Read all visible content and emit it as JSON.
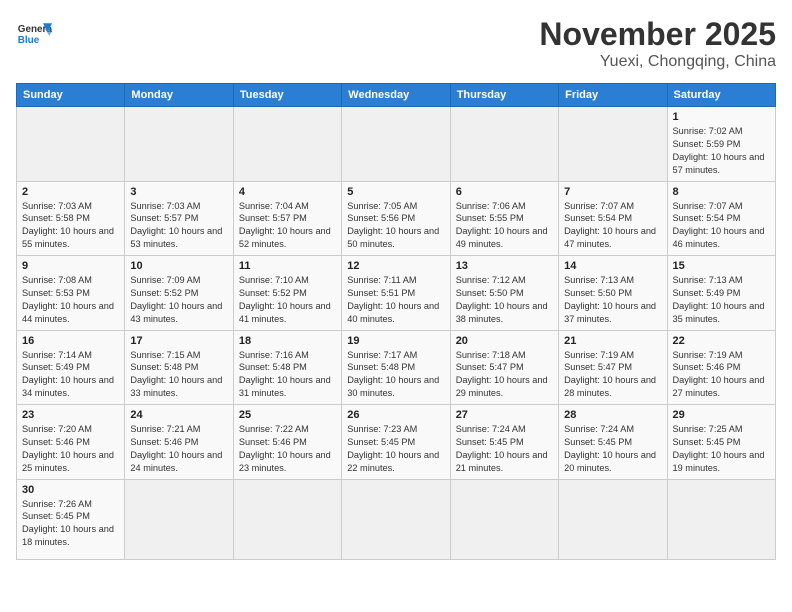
{
  "header": {
    "logo_general": "General",
    "logo_blue": "Blue",
    "title": "November 2025",
    "subtitle": "Yuexi, Chongqing, China"
  },
  "days_of_week": [
    "Sunday",
    "Monday",
    "Tuesday",
    "Wednesday",
    "Thursday",
    "Friday",
    "Saturday"
  ],
  "weeks": [
    [
      {
        "day": "",
        "info": ""
      },
      {
        "day": "",
        "info": ""
      },
      {
        "day": "",
        "info": ""
      },
      {
        "day": "",
        "info": ""
      },
      {
        "day": "",
        "info": ""
      },
      {
        "day": "",
        "info": ""
      },
      {
        "day": "1",
        "info": "Sunrise: 7:02 AM\nSunset: 5:59 PM\nDaylight: 10 hours and 57 minutes."
      }
    ],
    [
      {
        "day": "2",
        "info": "Sunrise: 7:03 AM\nSunset: 5:58 PM\nDaylight: 10 hours and 55 minutes."
      },
      {
        "day": "3",
        "info": "Sunrise: 7:03 AM\nSunset: 5:57 PM\nDaylight: 10 hours and 53 minutes."
      },
      {
        "day": "4",
        "info": "Sunrise: 7:04 AM\nSunset: 5:57 PM\nDaylight: 10 hours and 52 minutes."
      },
      {
        "day": "5",
        "info": "Sunrise: 7:05 AM\nSunset: 5:56 PM\nDaylight: 10 hours and 50 minutes."
      },
      {
        "day": "6",
        "info": "Sunrise: 7:06 AM\nSunset: 5:55 PM\nDaylight: 10 hours and 49 minutes."
      },
      {
        "day": "7",
        "info": "Sunrise: 7:07 AM\nSunset: 5:54 PM\nDaylight: 10 hours and 47 minutes."
      },
      {
        "day": "8",
        "info": "Sunrise: 7:07 AM\nSunset: 5:54 PM\nDaylight: 10 hours and 46 minutes."
      }
    ],
    [
      {
        "day": "9",
        "info": "Sunrise: 7:08 AM\nSunset: 5:53 PM\nDaylight: 10 hours and 44 minutes."
      },
      {
        "day": "10",
        "info": "Sunrise: 7:09 AM\nSunset: 5:52 PM\nDaylight: 10 hours and 43 minutes."
      },
      {
        "day": "11",
        "info": "Sunrise: 7:10 AM\nSunset: 5:52 PM\nDaylight: 10 hours and 41 minutes."
      },
      {
        "day": "12",
        "info": "Sunrise: 7:11 AM\nSunset: 5:51 PM\nDaylight: 10 hours and 40 minutes."
      },
      {
        "day": "13",
        "info": "Sunrise: 7:12 AM\nSunset: 5:50 PM\nDaylight: 10 hours and 38 minutes."
      },
      {
        "day": "14",
        "info": "Sunrise: 7:13 AM\nSunset: 5:50 PM\nDaylight: 10 hours and 37 minutes."
      },
      {
        "day": "15",
        "info": "Sunrise: 7:13 AM\nSunset: 5:49 PM\nDaylight: 10 hours and 35 minutes."
      }
    ],
    [
      {
        "day": "16",
        "info": "Sunrise: 7:14 AM\nSunset: 5:49 PM\nDaylight: 10 hours and 34 minutes."
      },
      {
        "day": "17",
        "info": "Sunrise: 7:15 AM\nSunset: 5:48 PM\nDaylight: 10 hours and 33 minutes."
      },
      {
        "day": "18",
        "info": "Sunrise: 7:16 AM\nSunset: 5:48 PM\nDaylight: 10 hours and 31 minutes."
      },
      {
        "day": "19",
        "info": "Sunrise: 7:17 AM\nSunset: 5:48 PM\nDaylight: 10 hours and 30 minutes."
      },
      {
        "day": "20",
        "info": "Sunrise: 7:18 AM\nSunset: 5:47 PM\nDaylight: 10 hours and 29 minutes."
      },
      {
        "day": "21",
        "info": "Sunrise: 7:19 AM\nSunset: 5:47 PM\nDaylight: 10 hours and 28 minutes."
      },
      {
        "day": "22",
        "info": "Sunrise: 7:19 AM\nSunset: 5:46 PM\nDaylight: 10 hours and 27 minutes."
      }
    ],
    [
      {
        "day": "23",
        "info": "Sunrise: 7:20 AM\nSunset: 5:46 PM\nDaylight: 10 hours and 25 minutes."
      },
      {
        "day": "24",
        "info": "Sunrise: 7:21 AM\nSunset: 5:46 PM\nDaylight: 10 hours and 24 minutes."
      },
      {
        "day": "25",
        "info": "Sunrise: 7:22 AM\nSunset: 5:46 PM\nDaylight: 10 hours and 23 minutes."
      },
      {
        "day": "26",
        "info": "Sunrise: 7:23 AM\nSunset: 5:45 PM\nDaylight: 10 hours and 22 minutes."
      },
      {
        "day": "27",
        "info": "Sunrise: 7:24 AM\nSunset: 5:45 PM\nDaylight: 10 hours and 21 minutes."
      },
      {
        "day": "28",
        "info": "Sunrise: 7:24 AM\nSunset: 5:45 PM\nDaylight: 10 hours and 20 minutes."
      },
      {
        "day": "29",
        "info": "Sunrise: 7:25 AM\nSunset: 5:45 PM\nDaylight: 10 hours and 19 minutes."
      }
    ],
    [
      {
        "day": "30",
        "info": "Sunrise: 7:26 AM\nSunset: 5:45 PM\nDaylight: 10 hours and 18 minutes."
      },
      {
        "day": "",
        "info": ""
      },
      {
        "day": "",
        "info": ""
      },
      {
        "day": "",
        "info": ""
      },
      {
        "day": "",
        "info": ""
      },
      {
        "day": "",
        "info": ""
      },
      {
        "day": "",
        "info": ""
      }
    ]
  ]
}
